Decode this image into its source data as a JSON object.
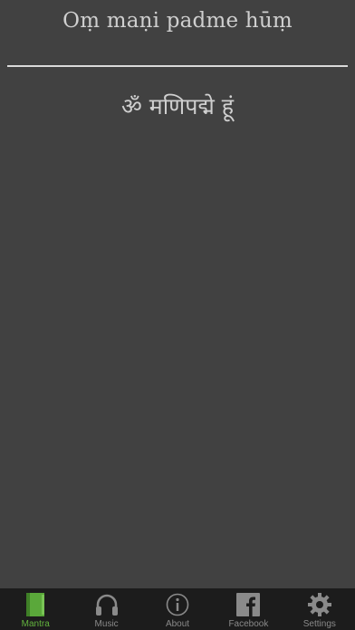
{
  "header": {
    "title": "Oṃ maṇi padme hūṃ",
    "devanagari": "ॐ मणिपद्मे हूं"
  },
  "tabbar": {
    "tabs": [
      {
        "label": "Mantra",
        "icon": "book-icon",
        "active": true
      },
      {
        "label": "Music",
        "icon": "headphones-icon",
        "active": false
      },
      {
        "label": "About",
        "icon": "info-icon",
        "active": false
      },
      {
        "label": "Facebook",
        "icon": "facebook-icon",
        "active": false
      },
      {
        "label": "Settings",
        "icon": "gear-icon",
        "active": false
      }
    ]
  },
  "colors": {
    "background": "#414141",
    "text": "#cfcfcf",
    "tabbar": "#1c1c1c",
    "active": "#63b33e",
    "inactive": "#8a8a8a"
  }
}
